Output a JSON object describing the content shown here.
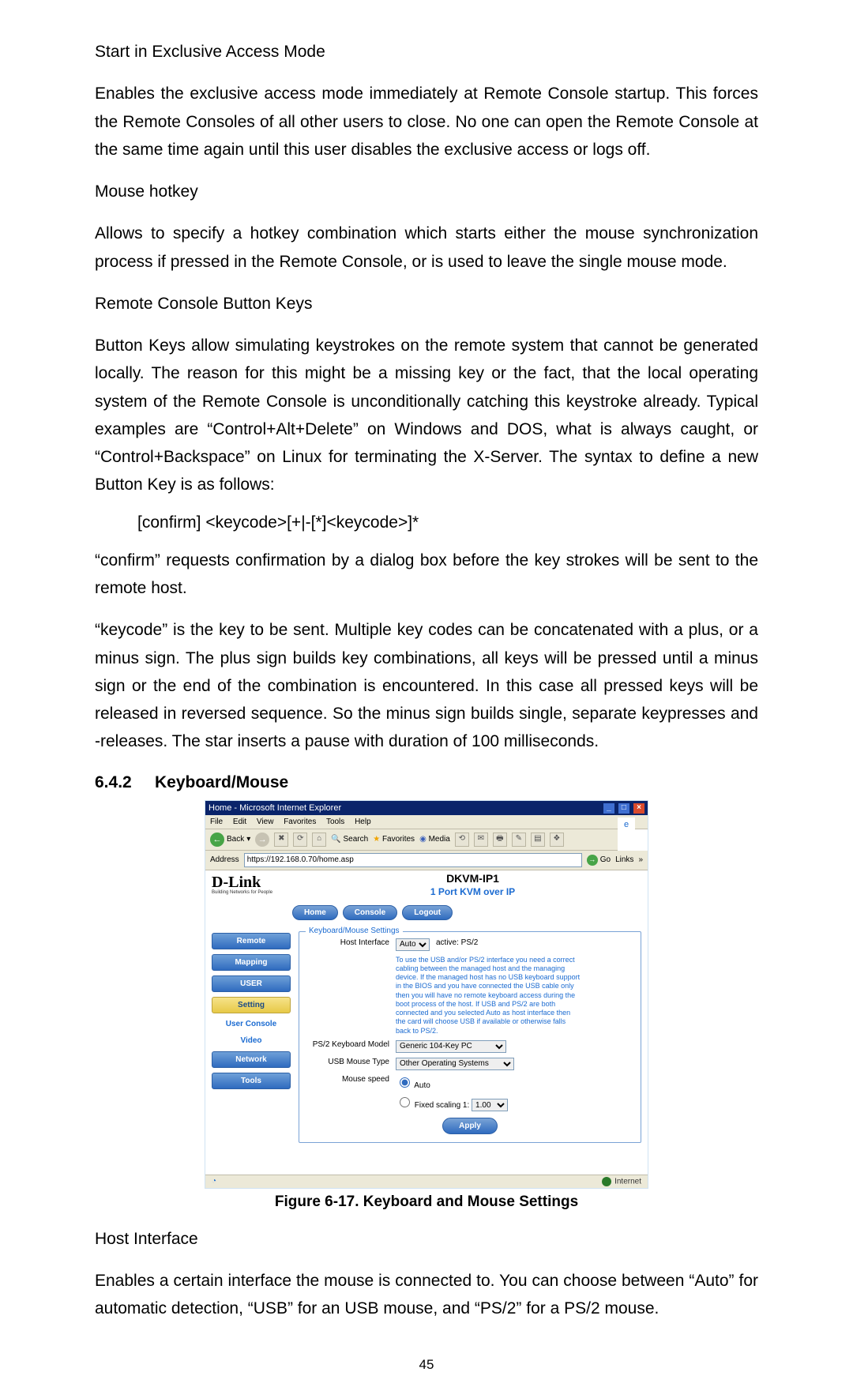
{
  "sec1_title": "Start in Exclusive Access Mode",
  "sec1_body": "Enables the exclusive access mode immediately at Remote Console startup. This forces the Remote Consoles of all other users to close. No one can open the Remote Console at the same time again until this user disables the exclusive access or logs off.",
  "sec2_title": "Mouse hotkey",
  "sec2_body": "Allows to specify a hotkey combination which starts either the mouse synchronization process if pressed in the Remote Console, or is used to leave the single mouse mode.",
  "sec3_title": "Remote Console Button Keys",
  "sec3_body": "Button Keys allow simulating keystrokes on the remote system that cannot be generated locally. The reason for this might be a missing key or the fact, that the local operating system of the Remote Console is unconditionally catching this keystroke already. Typical examples are “Control+Alt+Delete” on Windows and DOS, what is always caught, or “Control+Backspace” on Linux for terminating the X-Server. The syntax to define a new Button Key is as follows:",
  "syntax_line": "[confirm] <keycode>[+|-[*]<keycode>]*",
  "confirm_body": "“confirm” requests confirmation by a dialog box before the key strokes will be sent to the remote host.",
  "keycode_body": "“keycode” is the key to be sent. Multiple key codes can be concatenated with a plus, or a minus sign. The plus sign builds key combinations, all keys will be pressed until a minus sign or the end of the combination is encountered. In this case all pressed keys will be released in reversed sequence. So the minus sign builds single, separate keypresses and -releases. The star inserts a pause with duration of 100 milliseconds.",
  "section_no": "6.4.2",
  "section_name": "Keyboard/Mouse",
  "fig_caption": "Figure 6-17. Keyboard and Mouse Settings",
  "host_title": "Host Interface",
  "host_body": "Enables a certain interface the mouse is connected to. You can choose between “Auto” for automatic detection, “USB” for an USB mouse, and “PS/2” for a PS/2 mouse.",
  "page_number": "45",
  "ie": {
    "titlebar": "Home - Microsoft Internet Explorer",
    "menu": {
      "file": "File",
      "edit": "Edit",
      "view": "View",
      "fav": "Favorites",
      "tools": "Tools",
      "help": "Help"
    },
    "back": "Back",
    "search": "Search",
    "favorites": "Favorites",
    "media": "Media",
    "address_label": "Address",
    "address_value": "https://192.168.0.70/home.asp",
    "go": "Go",
    "links": "Links",
    "status_right": "Internet",
    "status_lock": " "
  },
  "app": {
    "brand": "D-Link",
    "brand_sub": "Building Networks for People",
    "product": "DKVM-IP1",
    "product_sub": "1 Port KVM over IP",
    "tabs": {
      "home": "Home",
      "console": "Console",
      "logout": "Logout"
    },
    "side": {
      "remote": "Remote",
      "mapping": "Mapping",
      "user": "USER",
      "setting": "Setting",
      "userconsole": "User Console",
      "video": "Video",
      "network": "Network",
      "tools": "Tools"
    },
    "fieldset_legend": "Keyboard/Mouse Settings",
    "host_if_label": "Host Interface",
    "host_if_value": "Auto",
    "host_if_active": "active: PS/2",
    "host_if_note": "To use the USB and/or PS/2 interface you need a correct cabling between the managed host and the managing device. If the managed host has no USB keyboard support in the BIOS and you have connected the USB cable only then you will have no remote keyboard access during the boot process of the host. If USB and PS/2 are both connected and you selected Auto as host interface then the card will choose USB if available or otherwise falls back to PS/2.",
    "ps2_label": "PS/2 Keyboard Model",
    "ps2_value": "Generic 104-Key PC",
    "usb_label": "USB Mouse Type",
    "usb_value": "Other Operating Systems",
    "speed_label": "Mouse speed",
    "speed_auto": "Auto",
    "speed_fixed": "Fixed scaling 1:",
    "speed_fixed_val": "1.00",
    "apply": "Apply"
  }
}
